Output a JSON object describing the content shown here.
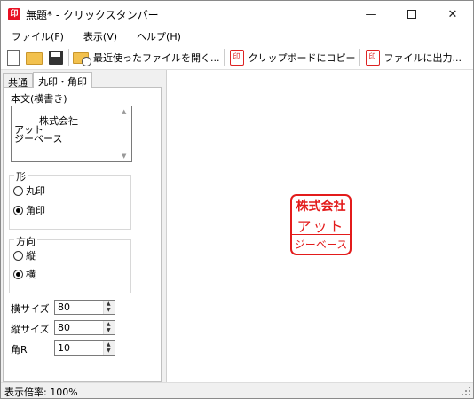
{
  "window": {
    "icon_text": "印",
    "title": "無題* - クリックスタンパー"
  },
  "menu": {
    "file": "ファイル(F)",
    "view": "表示(V)",
    "help": "ヘルプ(H)"
  },
  "toolbar": {
    "recent_label": "最近使ったファイルを開く...",
    "copy_label": "クリップボードにコピー",
    "export_label": "ファイルに出力...",
    "stamp_icon_text": "印"
  },
  "tabs": [
    {
      "label": "共通"
    },
    {
      "label": "丸印・角印"
    }
  ],
  "form": {
    "body_label": "本文(横書き)",
    "body_text": "株式会社\nアット\nジーベース",
    "shape_group": "形",
    "shape_options": [
      "丸印",
      "角印"
    ],
    "shape_selected": "角印",
    "direction_group": "方向",
    "direction_options": [
      "縦",
      "横"
    ],
    "direction_selected": "横",
    "width_label": "横サイズ",
    "width_value": "80",
    "height_label": "縦サイズ",
    "height_value": "80",
    "corner_label": "角R",
    "corner_value": "10"
  },
  "stamp": {
    "lines": [
      "株式会社",
      "アット",
      "ジーベース"
    ],
    "color": "#e31b1b"
  },
  "status": {
    "zoom_text": "表示倍率: 100%"
  }
}
